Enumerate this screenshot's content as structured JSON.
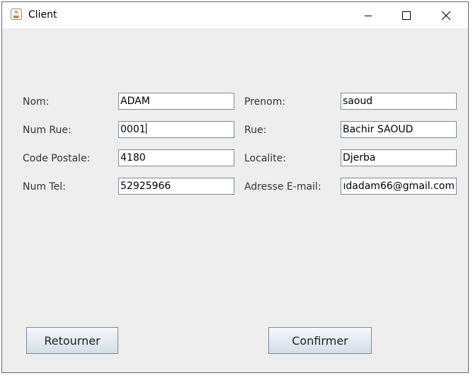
{
  "window": {
    "title": "Client",
    "app_icon": "java-cup-icon",
    "controls": {
      "minimize_icon": "minimize-icon",
      "maximize_icon": "maximize-icon",
      "close_icon": "close-icon"
    }
  },
  "form": {
    "nom": {
      "label": "Nom:",
      "value": "ADAM"
    },
    "prenom": {
      "label": "Prenom:",
      "value": "saoud"
    },
    "num_rue": {
      "label": "Num Rue:",
      "value": "0001"
    },
    "rue": {
      "label": "Rue:",
      "value": "Bachir SAOUD"
    },
    "code_postale": {
      "label": "Code Postale:",
      "value": "4180"
    },
    "localite": {
      "label": "Localite:",
      "value": "Djerba"
    },
    "num_tel": {
      "label": "Num Tel:",
      "value": "52925966"
    },
    "email": {
      "label": "Adresse E-mail:",
      "value": "ıdadam66@gmail.com"
    }
  },
  "buttons": {
    "retourner": "Retourner",
    "confirmer": "Confirmer"
  },
  "colors": {
    "background": "#eeeeee",
    "titlebar": "#ffffff",
    "field_border": "#7a8a99"
  }
}
